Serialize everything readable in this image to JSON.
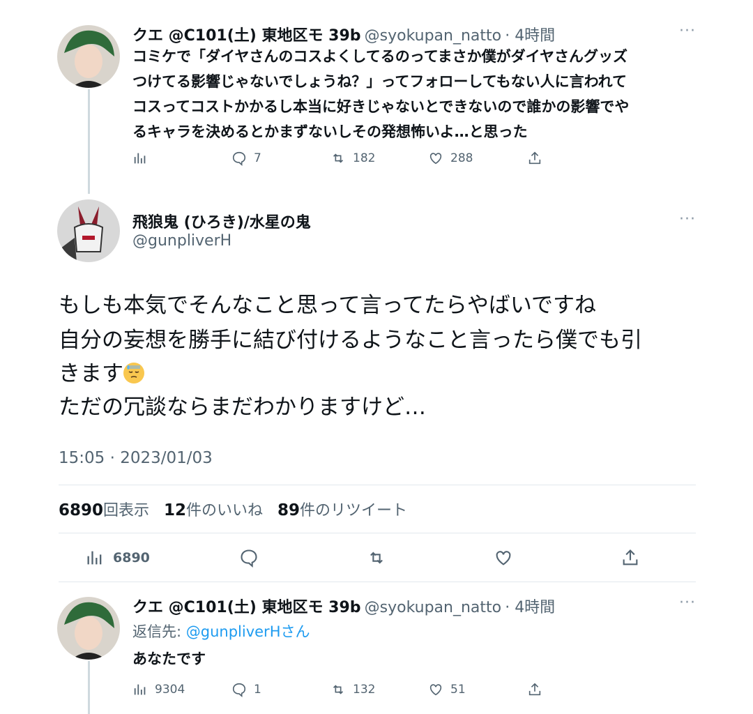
{
  "tweets": [
    {
      "name": "クエ @C101(土) 東地区モ 39b",
      "handle": "@syokupan_natto",
      "time": "· 4時間",
      "more": "···",
      "lines": [
        "コミケで「ダイヤさんのコスよくしてるのってまさか僕がダイヤさんグッズ",
        "つけてる影響じゃないでしょうね？」ってフォローしてもない人に言われて",
        "コスってコストかかるし本当に好きじゃないとできないので誰かの影響でや",
        "るキャラを決めるとかまずないしその発想怖いよ…と思った"
      ],
      "stats": {
        "views": "",
        "replies": "7",
        "retweets": "182",
        "likes": "288"
      }
    },
    {
      "name": "飛狼鬼 (ひろき)/水星の鬼",
      "handle": "@gunpliverH",
      "more": "···",
      "lines": [
        "もしも本気でそんなこと思って言ってたらやばいですね",
        "自分の妄想を勝手に結び付けるようなこと言ったら僕でも引",
        "きます",
        "ただの冗談ならまだわかりますけど…"
      ],
      "emoji": "downcast-face-with-sweat",
      "timestamp": "15:05 · 2023/01/03",
      "counts": {
        "views_num": "6890",
        "views_label": "回表示",
        "likes_num": "12",
        "likes_label": "件のいいね",
        "retweets_num": "89",
        "retweets_label": "件のリツイート"
      },
      "actions": {
        "views": "6890"
      }
    },
    {
      "name": "クエ @C101(土) 東地区モ 39b",
      "handle": "@syokupan_natto",
      "time": "· 4時間",
      "more": "···",
      "reply_prefix": "返信先:",
      "reply_mention": "@gunpliverHさん",
      "text": "あなたです",
      "stats": {
        "views": "9304",
        "replies": "1",
        "retweets": "132",
        "likes": "51"
      }
    }
  ],
  "colors": {
    "link": "#1d9bf0",
    "secondary": "#536471",
    "divider": "#e1e8ed"
  }
}
